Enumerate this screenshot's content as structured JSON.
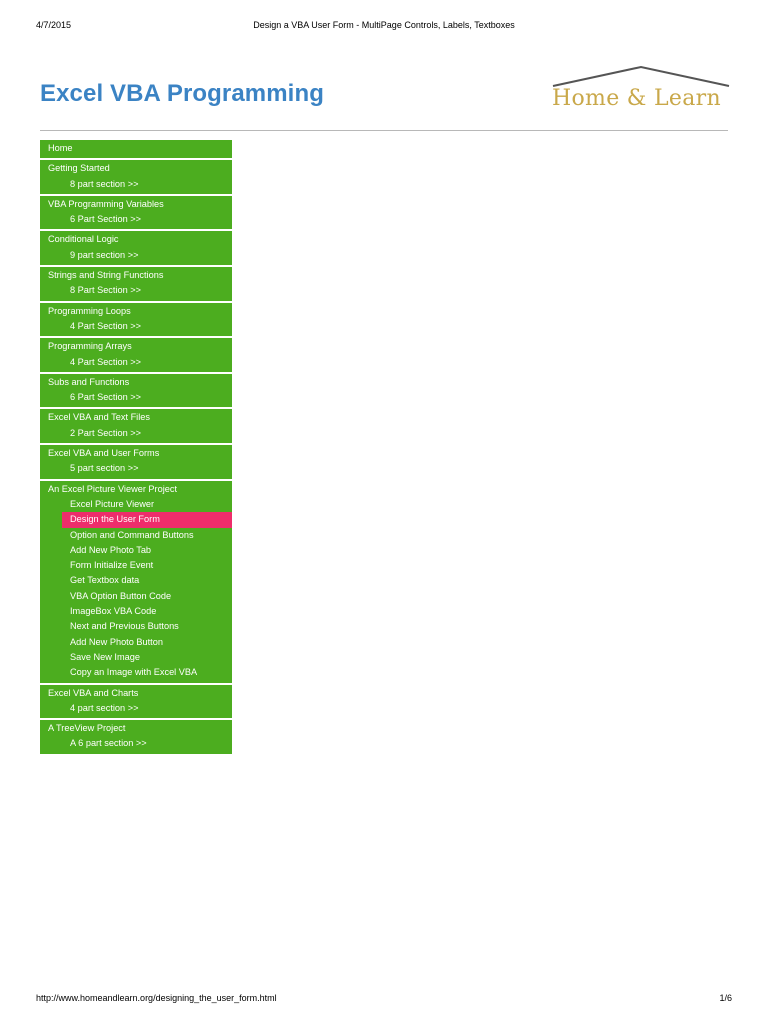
{
  "print_header": {
    "date": "4/7/2015",
    "title": "Design a VBA User Form - MultiPage Controls, Labels, Textboxes"
  },
  "site": {
    "title": "Excel VBA Programming",
    "logo_text": "Home & Learn"
  },
  "colors": {
    "title_blue": "#3b83c4",
    "nav_green": "#4cad1f",
    "active_pink": "#ee2d6b",
    "logo_gold": "#c9a84a"
  },
  "nav": [
    {
      "label": "Home",
      "sub": []
    },
    {
      "label": "Getting Started",
      "sub": [
        "8 part section >>"
      ]
    },
    {
      "label": "VBA Programming Variables",
      "sub": [
        "6 Part Section >>"
      ]
    },
    {
      "label": "Conditional Logic",
      "sub": [
        "9 part section >>"
      ]
    },
    {
      "label": "Strings and String Functions",
      "sub": [
        "8 Part Section >>"
      ]
    },
    {
      "label": "Programming Loops",
      "sub": [
        "4 Part Section >>"
      ]
    },
    {
      "label": "Programming Arrays",
      "sub": [
        "4 Part Section >>"
      ]
    },
    {
      "label": "Subs and Functions",
      "sub": [
        "6 Part Section >>"
      ]
    },
    {
      "label": "Excel VBA and Text Files",
      "sub": [
        "2 Part Section >>"
      ]
    },
    {
      "label": "Excel VBA and User Forms",
      "sub": [
        "5 part section >>"
      ]
    },
    {
      "label": "An Excel Picture Viewer Project",
      "sub": [
        "Excel Picture Viewer",
        "Design the User Form",
        "Option and Command Buttons",
        "Add New Photo Tab",
        "Form Initialize Event",
        "Get Textbox data",
        "VBA Option Button Code",
        "ImageBox VBA Code",
        "Next and Previous Buttons",
        "Add New Photo Button",
        "Save New Image",
        "Copy an Image with Excel VBA"
      ],
      "active": "Design the User Form"
    },
    {
      "label": "Excel VBA and Charts",
      "sub": [
        "4 part section >>"
      ]
    },
    {
      "label": "A TreeView Project",
      "sub": [
        "A 6 part section >>"
      ]
    }
  ],
  "print_footer": {
    "url": "http://www.homeandlearn.org/designing_the_user_form.html",
    "page": "1/6"
  }
}
